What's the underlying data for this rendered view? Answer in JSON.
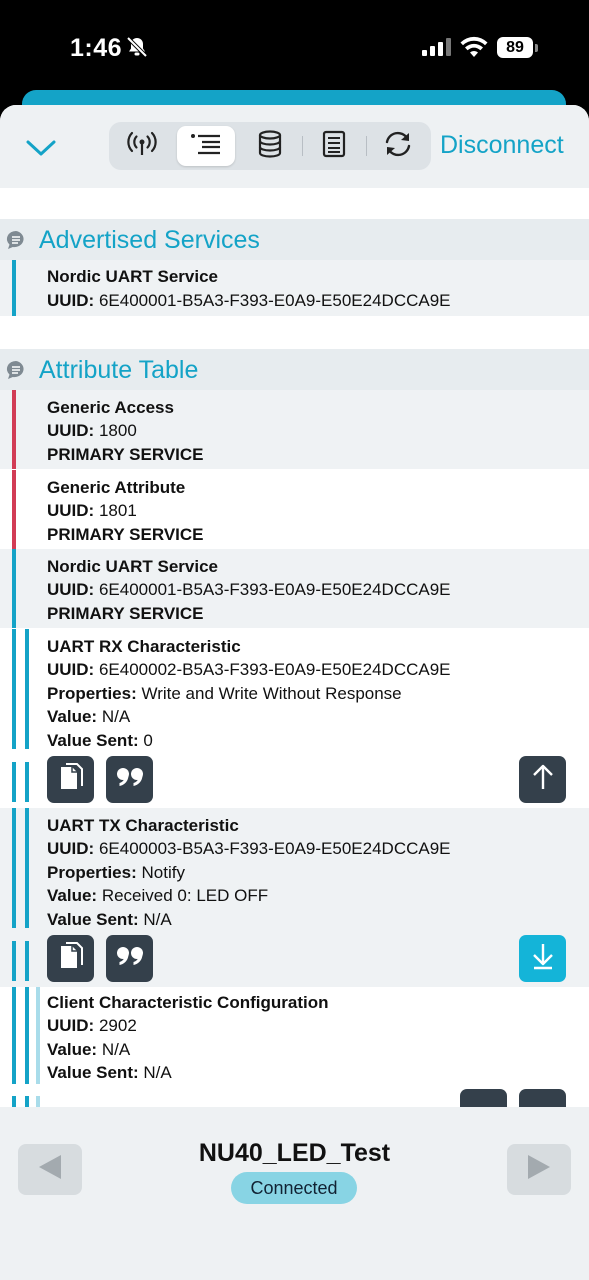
{
  "status_bar": {
    "time": "1:46",
    "battery": "89"
  },
  "toolbar": {
    "disconnect_label": "Disconnect"
  },
  "advertised": {
    "title": "Advertised Services",
    "service_name": "Nordic UART Service",
    "uuid_label": "UUID:",
    "uuid": "6E400001-B5A3-F393-E0A9-E50E24DCCA9E"
  },
  "attribute_table": {
    "title": "Attribute Table",
    "generic_access": {
      "name": "Generic Access",
      "uuid_label": "UUID:",
      "uuid": "1800",
      "type": "PRIMARY SERVICE"
    },
    "generic_attribute": {
      "name": "Generic Attribute",
      "uuid_label": "UUID:",
      "uuid": "1801",
      "type": "PRIMARY SERVICE"
    },
    "nordic_uart": {
      "name": "Nordic UART Service",
      "uuid_label": "UUID:",
      "uuid": "6E400001-B5A3-F393-E0A9-E50E24DCCA9E",
      "type": "PRIMARY SERVICE"
    },
    "uart_rx": {
      "name": "UART RX Characteristic",
      "uuid_label": "UUID:",
      "uuid": "6E400002-B5A3-F393-E0A9-E50E24DCCA9E",
      "properties_label": "Properties:",
      "properties": "Write and Write Without Response",
      "value_label": "Value:",
      "value": "N/A",
      "value_sent_label": "Value Sent:",
      "value_sent": "0"
    },
    "uart_tx": {
      "name": "UART TX Characteristic",
      "uuid_label": "UUID:",
      "uuid": "6E400003-B5A3-F393-E0A9-E50E24DCCA9E",
      "properties_label": "Properties:",
      "properties": "Notify",
      "value_label": "Value:",
      "value": "Received 0: LED OFF",
      "value_sent_label": "Value Sent:",
      "value_sent": "N/A"
    },
    "cccd": {
      "name": "Client Characteristic Configuration",
      "uuid_label": "UUID:",
      "uuid": "2902",
      "value_label": "Value:",
      "value": "N/A",
      "value_sent_label": "Value Sent:",
      "value_sent": "N/A"
    }
  },
  "footer": {
    "device_name": "NU40_LED_Test",
    "connection_status": "Connected"
  },
  "colors": {
    "accent": "#14a3c7",
    "service_bar_red": "#d23c55",
    "dark_button": "#34404b",
    "teal_button": "#14b4d8"
  },
  "icons": [
    "bell-slash-icon",
    "signal-icon",
    "wifi-icon",
    "chevron-down-icon",
    "antenna-icon",
    "list-icon",
    "database-icon",
    "log-icon",
    "refresh-icon",
    "message-icon",
    "copy-icon",
    "quote-icon",
    "arrow-up-icon",
    "arrow-down-icon",
    "triangle-left-icon",
    "triangle-right-icon"
  ]
}
